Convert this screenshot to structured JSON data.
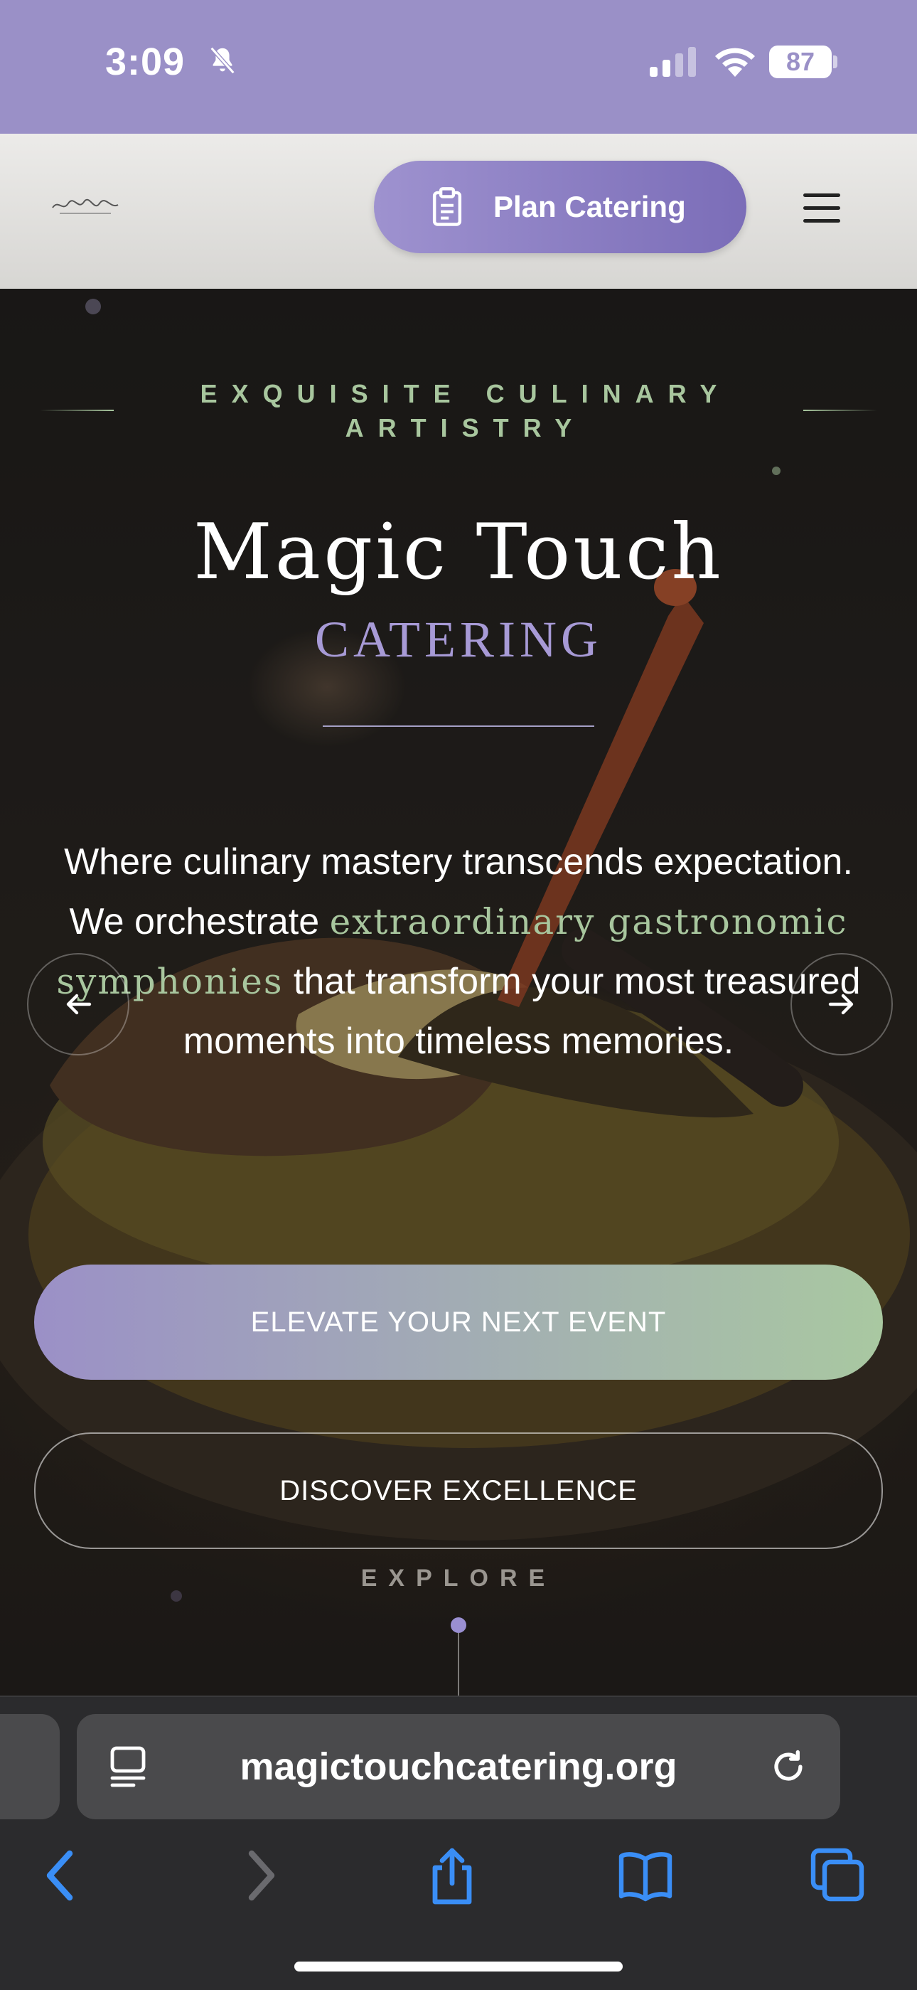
{
  "status_bar": {
    "time": "3:09",
    "battery": "87",
    "icons": [
      "bell-slash-icon",
      "cellular-signal-icon",
      "wifi-icon",
      "battery-icon"
    ]
  },
  "header": {
    "logo_alt": "Magic Touch logo",
    "plan_button_label": "Plan Catering",
    "plan_button_icon": "clipboard-icon",
    "menu_icon": "hamburger-menu-icon"
  },
  "hero": {
    "eyebrow": "EXQUISITE CULINARY ARTISTRY",
    "title": "Magic Touch",
    "subtitle": "CATERING",
    "tagline_before": "Where culinary mastery transcends expectation. We orchestrate ",
    "tagline_accent": "extraordinary gastronomic symphonies",
    "tagline_after": " that transform your most treasured moments into timeless memories.",
    "primary_cta": "ELEVATE YOUR NEXT EVENT",
    "secondary_cta": "DISCOVER EXCELLENCE",
    "explore_label": "EXPLORE",
    "prev_icon": "arrow-left-icon",
    "next_icon": "arrow-right-icon"
  },
  "browser": {
    "url": "magictouchcatering.org",
    "toolbar_icons": [
      "back-icon",
      "forward-icon",
      "share-icon",
      "bookmarks-icon",
      "tabs-icon"
    ]
  },
  "colors": {
    "status_bar": "#9a90c7",
    "brand_purple": "#7b6db8",
    "accent_green": "#a8c69e",
    "subtitle_purple": "#a79ad6",
    "ios_blue": "#3a8ef6"
  }
}
